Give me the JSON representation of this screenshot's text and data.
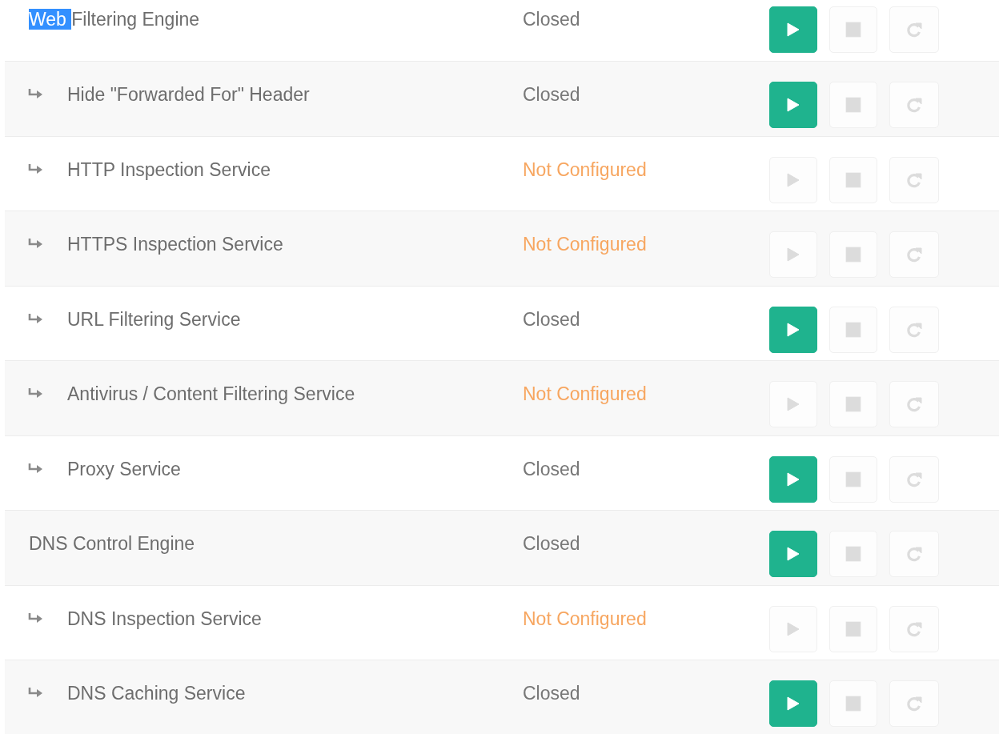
{
  "services": [
    {
      "selected_text": "Web ",
      "name": "Filtering Engine",
      "status": "Closed",
      "color": "#777777",
      "buttons": [
        {
          "kind": "start",
          "disabled": false
        },
        {
          "kind": "stop",
          "disabled": true
        },
        {
          "kind": "restart",
          "disabled": true
        }
      ],
      "children": [
        {
          "name": "Hide \"Forwarded For\" Header",
          "status": "Closed",
          "color": "#777777",
          "buttons": [
            {
              "kind": "start",
              "disabled": false
            },
            {
              "kind": "stop",
              "disabled": true
            },
            {
              "kind": "restart",
              "disabled": true
            }
          ]
        },
        {
          "name": "HTTP Inspection Service",
          "status": "Not Configured",
          "color": "#f7a660",
          "buttons": [
            {
              "kind": "start",
              "disabled": true
            },
            {
              "kind": "stop",
              "disabled": true
            },
            {
              "kind": "restart",
              "disabled": true
            }
          ]
        },
        {
          "name": "HTTPS Inspection Service",
          "status": "Not Configured",
          "color": "#f7a660",
          "buttons": [
            {
              "kind": "start",
              "disabled": true
            },
            {
              "kind": "stop",
              "disabled": true
            },
            {
              "kind": "restart",
              "disabled": true
            }
          ]
        },
        {
          "name": "URL Filtering Service",
          "status": "Closed",
          "color": "#777777",
          "buttons": [
            {
              "kind": "start",
              "disabled": false
            },
            {
              "kind": "stop",
              "disabled": true
            },
            {
              "kind": "restart",
              "disabled": true
            }
          ]
        },
        {
          "name": "Antivirus / Content Filtering Service",
          "status": "Not Configured",
          "color": "#f7a660",
          "buttons": [
            {
              "kind": "start",
              "disabled": true
            },
            {
              "kind": "stop",
              "disabled": true
            },
            {
              "kind": "restart",
              "disabled": true
            }
          ]
        },
        {
          "name": "Proxy Service",
          "status": "Closed",
          "color": "#777777",
          "buttons": [
            {
              "kind": "start",
              "disabled": false
            },
            {
              "kind": "stop",
              "disabled": true
            },
            {
              "kind": "restart",
              "disabled": true
            }
          ]
        }
      ]
    },
    {
      "name": "DNS Control Engine",
      "status": "Closed",
      "color": "#777777",
      "buttons": [
        {
          "kind": "start",
          "disabled": false
        },
        {
          "kind": "stop",
          "disabled": true
        },
        {
          "kind": "restart",
          "disabled": true
        }
      ],
      "children": [
        {
          "name": "DNS Inspection Service",
          "status": "Not Configured",
          "color": "#f7a660",
          "buttons": [
            {
              "kind": "start",
              "disabled": true
            },
            {
              "kind": "stop",
              "disabled": true
            },
            {
              "kind": "restart",
              "disabled": true
            }
          ]
        },
        {
          "name": "DNS Caching Service",
          "status": "Closed",
          "color": "#777777",
          "buttons": [
            {
              "kind": "start",
              "disabled": false
            },
            {
              "kind": "stop",
              "disabled": true
            },
            {
              "kind": "restart",
              "disabled": true
            }
          ]
        }
      ]
    }
  ]
}
